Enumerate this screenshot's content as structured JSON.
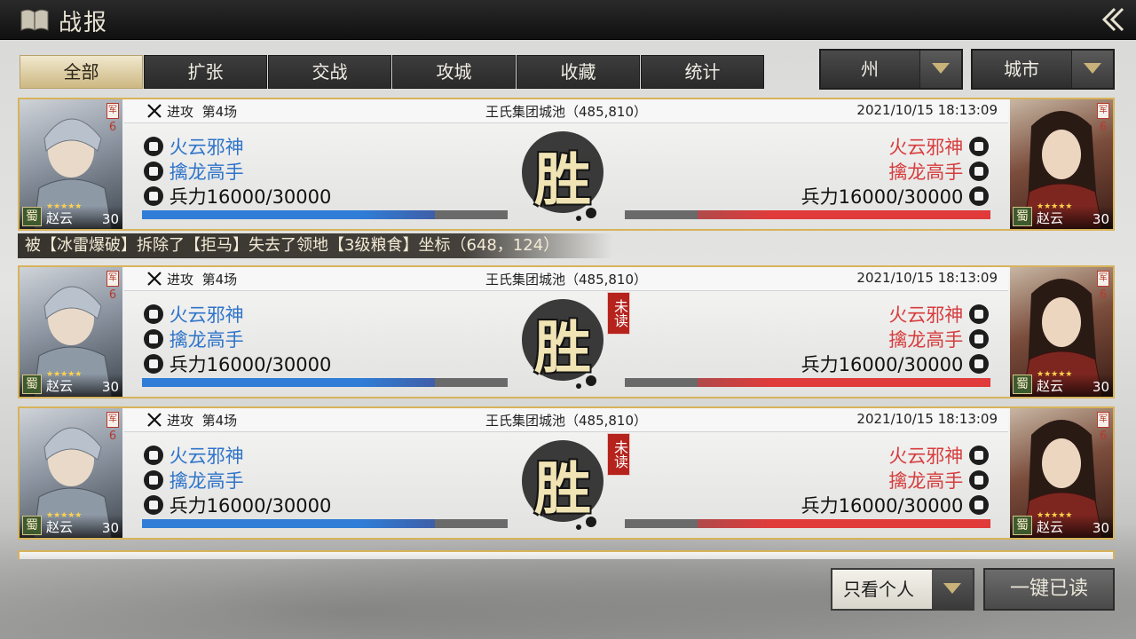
{
  "header": {
    "title": "战报"
  },
  "tabs": [
    "全部",
    "扩张",
    "交战",
    "攻城",
    "收藏",
    "统计"
  ],
  "filters": {
    "region": "州",
    "city": "城市"
  },
  "reports": [
    {
      "attack_label": "进攻",
      "round": "第4场",
      "location": "王氏集团城池（485,810）",
      "time": "2021/10/15  18:13:09",
      "result": "胜",
      "unread": false,
      "left": {
        "name": "火云邪神",
        "title": "擒龙高手",
        "troops": "兵力16000/30000",
        "troop_fraction": 0.8,
        "hero": "赵云",
        "faction": "蜀",
        "level": "30",
        "cost_tag": "军",
        "cost": "6",
        "stars": "★★★★★"
      },
      "right": {
        "name": "火云邪神",
        "title": "擒龙高手",
        "troops": "兵力16000/30000",
        "troop_fraction": 0.8,
        "hero": "赵云",
        "faction": "蜀",
        "level": "30",
        "cost_tag": "军",
        "cost": "6",
        "stars": "★★★★★"
      }
    },
    {
      "attack_label": "进攻",
      "round": "第4场",
      "location": "王氏集团城池（485,810）",
      "time": "2021/10/15  18:13:09",
      "result": "胜",
      "unread": true,
      "unread_label": "未读",
      "left": {
        "name": "火云邪神",
        "title": "擒龙高手",
        "troops": "兵力16000/30000",
        "troop_fraction": 0.8,
        "hero": "赵云",
        "faction": "蜀",
        "level": "30",
        "cost_tag": "军",
        "cost": "6",
        "stars": "★★★★★"
      },
      "right": {
        "name": "火云邪神",
        "title": "擒龙高手",
        "troops": "兵力16000/30000",
        "troop_fraction": 0.8,
        "hero": "赵云",
        "faction": "蜀",
        "level": "30",
        "cost_tag": "军",
        "cost": "6",
        "stars": "★★★★★"
      }
    },
    {
      "attack_label": "进攻",
      "round": "第4场",
      "location": "王氏集团城池（485,810）",
      "time": "2021/10/15  18:13:09",
      "result": "胜",
      "unread": true,
      "unread_label": "未读",
      "left": {
        "name": "火云邪神",
        "title": "擒龙高手",
        "troops": "兵力16000/30000",
        "troop_fraction": 0.8,
        "hero": "赵云",
        "faction": "蜀",
        "level": "30",
        "cost_tag": "军",
        "cost": "6",
        "stars": "★★★★★"
      },
      "right": {
        "name": "火云邪神",
        "title": "擒龙高手",
        "troops": "兵力16000/30000",
        "troop_fraction": 0.8,
        "hero": "赵云",
        "faction": "蜀",
        "level": "30",
        "cost_tag": "军",
        "cost": "6",
        "stars": "★★★★★"
      }
    }
  ],
  "notice": "被【冰雷爆破】拆除了【拒马】失去了领地【3级粮食】坐标（648，124）",
  "footer": {
    "filter_label": "只看个人",
    "read_all_label": "一键已读"
  },
  "icons": {
    "title_icon": "book-icon",
    "back": "back-arrow-icon",
    "attack": "crossed-swords-icon",
    "name": "helmet-icon",
    "title": "commander-icon",
    "troops": "skull-icon",
    "dropdown": "triangle-down-icon"
  },
  "colors": {
    "accent_gold": "#d7b35a",
    "ally_blue": "#2f74c9",
    "enemy_red": "#d73c3c",
    "unread_red": "#b5231c"
  }
}
